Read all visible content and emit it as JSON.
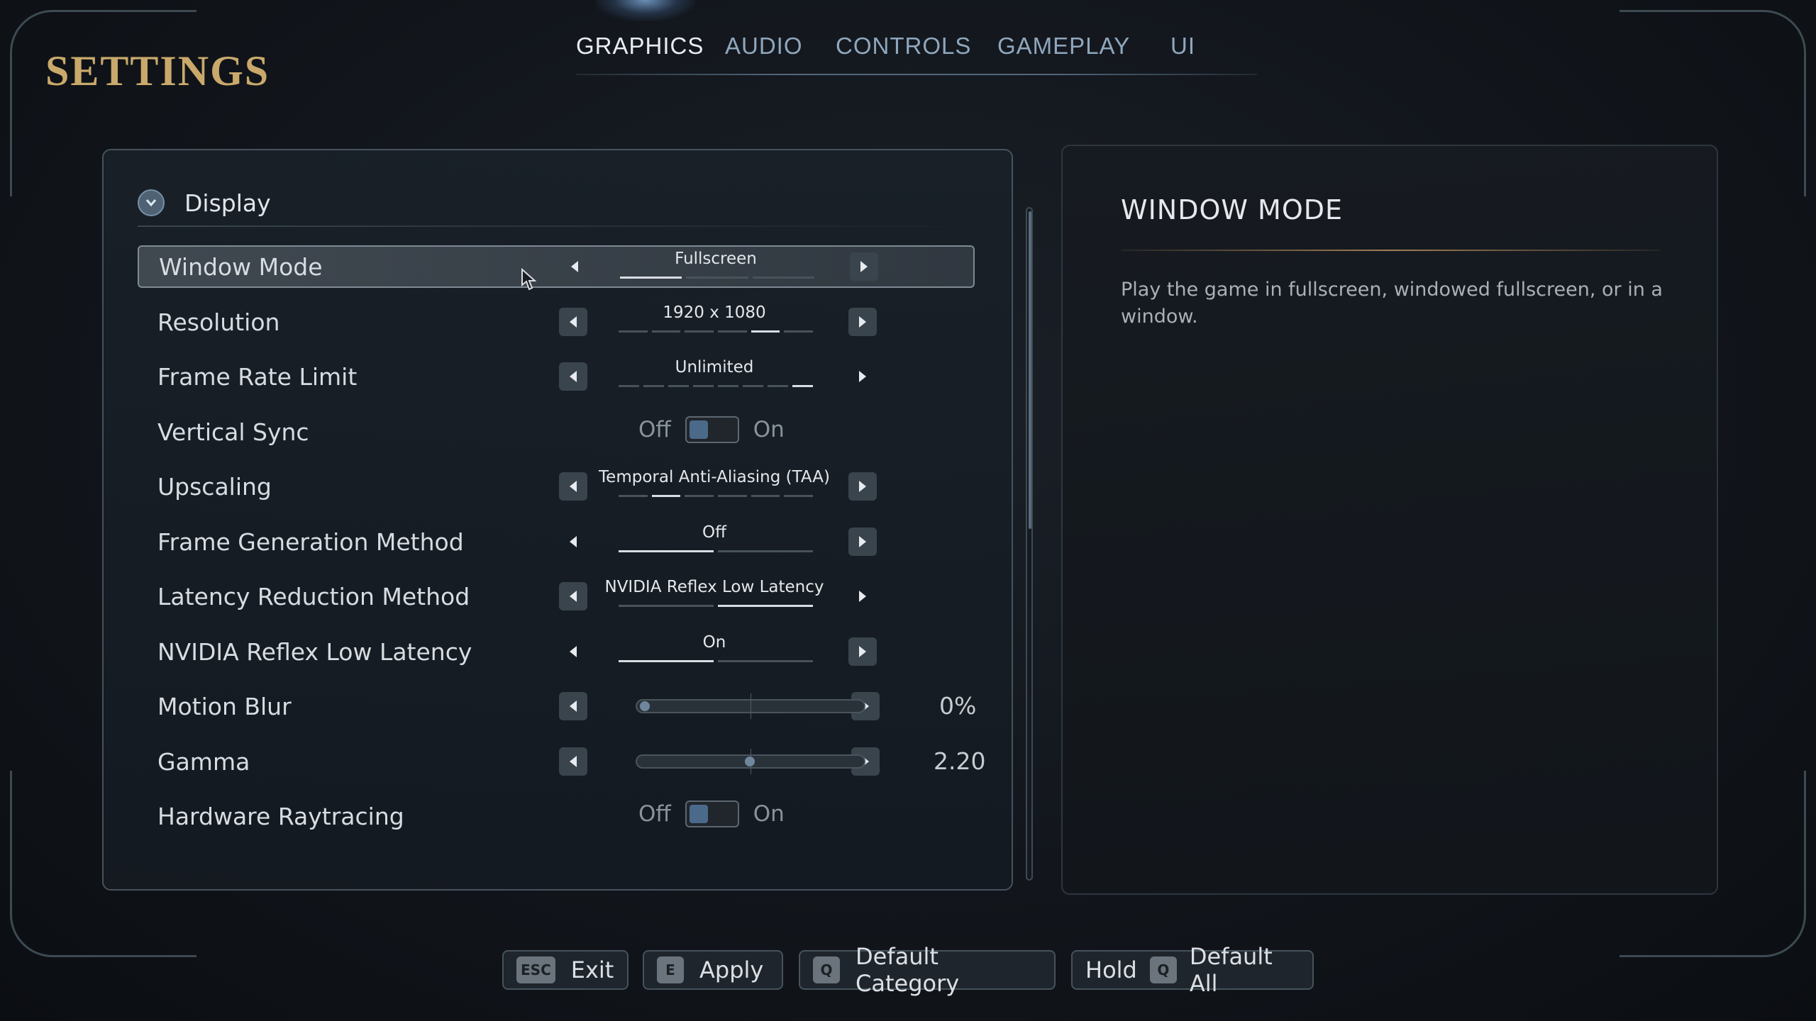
{
  "page": {
    "title": "SETTINGS"
  },
  "tabs": [
    {
      "label": "GRAPHICS",
      "active": true
    },
    {
      "label": "AUDIO"
    },
    {
      "label": "CONTROLS"
    },
    {
      "label": "GAMEPLAY"
    },
    {
      "label": "UI"
    }
  ],
  "section": {
    "label": "Display",
    "icon": "chevron-down-icon"
  },
  "settings": [
    {
      "label": "Window Mode",
      "type": "selector",
      "value": "Fullscreen",
      "segments": 3,
      "active_segment": 1
    },
    {
      "label": "Resolution",
      "type": "selector",
      "value": "1920 x 1080",
      "segments": 6,
      "active_segment": 5
    },
    {
      "label": "Frame Rate Limit",
      "type": "selector",
      "value": "Unlimited",
      "segments": 8,
      "active_segment": 8
    },
    {
      "label": "Vertical Sync",
      "type": "toggle",
      "off_label": "Off",
      "on_label": "On",
      "value": "Off"
    },
    {
      "label": "Upscaling",
      "type": "selector",
      "value": "Temporal Anti-Aliasing (TAA)",
      "segments": 6,
      "active_segment": 2
    },
    {
      "label": "Frame Generation Method",
      "type": "selector",
      "value": "Off",
      "segments": 2,
      "active_segment": 1
    },
    {
      "label": "Latency Reduction Method",
      "type": "selector",
      "value": "NVIDIA Reflex Low Latency",
      "segments": 2,
      "active_segment": 2
    },
    {
      "label": "NVIDIA Reflex Low Latency",
      "type": "selector",
      "value": "On",
      "segments": 2,
      "active_segment": 1
    },
    {
      "label": "Motion Blur",
      "type": "slider",
      "value": "0%",
      "fraction": 0.0
    },
    {
      "label": "Gamma",
      "type": "slider",
      "value": "2.20",
      "fraction": 0.5
    },
    {
      "label": "Hardware Raytracing",
      "type": "toggle",
      "off_label": "Off",
      "on_label": "On",
      "value": "Off"
    }
  ],
  "help": {
    "title": "WINDOW MODE",
    "text": "Play the game in fullscreen, windowed fullscreen, or in a window."
  },
  "actions": [
    {
      "key": "ESC",
      "label": "Exit"
    },
    {
      "key": "E",
      "label": "Apply"
    },
    {
      "key": "Q",
      "label": "Default Category"
    },
    {
      "prefix": "Hold",
      "key": "Q",
      "label": "Default All"
    }
  ]
}
